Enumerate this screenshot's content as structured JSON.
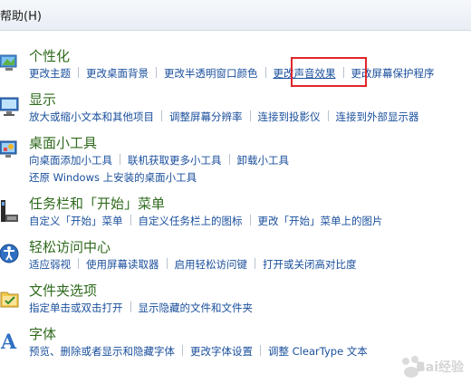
{
  "menu": {
    "help_label": "帮助(H)"
  },
  "categories": [
    {
      "title": "个性化",
      "icon": "personalization-icon",
      "rows": [
        [
          "更改主题",
          "更改桌面背景",
          "更改半透明窗口颜色",
          "更改声音效果",
          "更改屏幕保护程序"
        ]
      ]
    },
    {
      "title": "显示",
      "icon": "display-icon",
      "rows": [
        [
          "放大或缩小文本和其他项目",
          "调整屏幕分辨率",
          "连接到投影仪",
          "连接到外部显示器"
        ]
      ]
    },
    {
      "title": "桌面小工具",
      "icon": "gadgets-icon",
      "rows": [
        [
          "向桌面添加小工具",
          "联机获取更多小工具",
          "卸载小工具"
        ],
        [
          "还原 Windows 上安装的桌面小工具"
        ]
      ]
    },
    {
      "title": "任务栏和「开始」菜单",
      "icon": "taskbar-icon",
      "rows": [
        [
          "自定义「开始」菜单",
          "自定义任务栏上的图标",
          "更改「开始」菜单上的图片"
        ]
      ]
    },
    {
      "title": "轻松访问中心",
      "icon": "ease-of-access-icon",
      "rows": [
        [
          "适应弱视",
          "使用屏幕读取器",
          "启用轻松访问键",
          "打开或关闭高对比度"
        ]
      ]
    },
    {
      "title": "文件夹选项",
      "icon": "folder-options-icon",
      "rows": [
        [
          "指定单击或双击打开",
          "显示隐藏的文件和文件夹"
        ]
      ]
    },
    {
      "title": "字体",
      "icon": "fonts-icon",
      "rows": [
        [
          "预览、删除或者显示和隐藏字体",
          "更改字体设置",
          "调整 ClearType 文本"
        ]
      ]
    }
  ],
  "watermark": {
    "text": "Bai经验"
  }
}
